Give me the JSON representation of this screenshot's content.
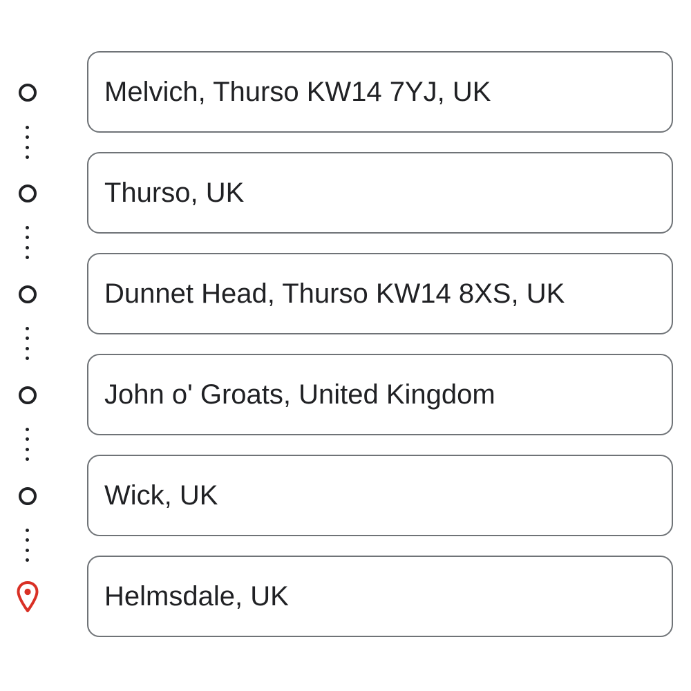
{
  "route": {
    "stops": [
      {
        "label": "Melvich, Thurso KW14 7YJ, UK",
        "icon": "waypoint-circle-icon"
      },
      {
        "label": "Thurso, UK",
        "icon": "waypoint-circle-icon"
      },
      {
        "label": "Dunnet Head, Thurso KW14 8XS, UK",
        "icon": "waypoint-circle-icon"
      },
      {
        "label": "John o' Groats, United Kingdom",
        "icon": "waypoint-circle-icon"
      },
      {
        "label": "Wick, UK",
        "icon": "waypoint-circle-icon"
      },
      {
        "label": "Helmsdale, UK",
        "icon": "destination-pin-icon"
      }
    ],
    "colors": {
      "waypoint": "#202124",
      "destination": "#d93025",
      "input_border": "#6f7377",
      "text": "#202124"
    }
  }
}
